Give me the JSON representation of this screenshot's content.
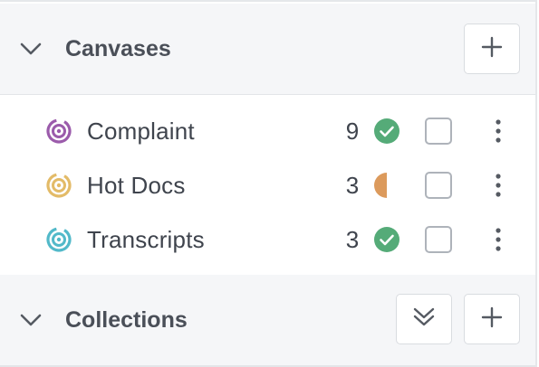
{
  "canvases": {
    "title": "Canvases",
    "items": [
      {
        "label": "Complaint",
        "count": "9",
        "status": "complete",
        "icon_color": "#9b5bab"
      },
      {
        "label": "Hot Docs",
        "count": "3",
        "status": "partial",
        "icon_color": "#e3bb68"
      },
      {
        "label": "Transcripts",
        "count": "3",
        "status": "complete",
        "icon_color": "#52b9c9"
      }
    ]
  },
  "collections": {
    "title": "Collections"
  },
  "icons": {
    "collapse": "chevron-down-icon",
    "add": "plus-icon",
    "expand_all": "double-chevron-down-icon",
    "status_complete": "check-circle-icon",
    "status_partial": "half-circle-icon",
    "menu": "more-vertical-icon",
    "canvas": "target-icon"
  },
  "colors": {
    "complete_green": "#55ab78",
    "partial_orange": "#dc9a5c",
    "header_bg": "#f5f6f8"
  }
}
